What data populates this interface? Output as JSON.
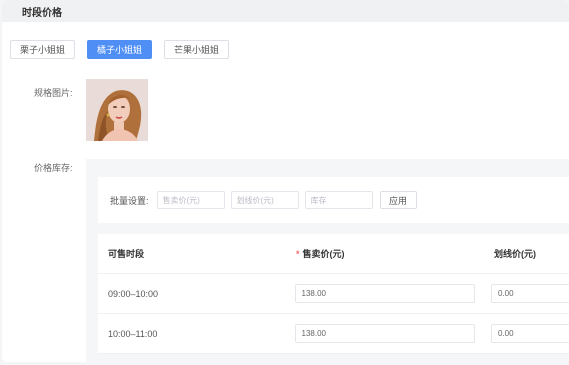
{
  "header": {
    "title": "时段价格"
  },
  "tabs": [
    {
      "label": "栗子小姐姐",
      "active": false
    },
    {
      "label": "橘子小姐姐",
      "active": true
    },
    {
      "label": "芒果小姐姐",
      "active": false
    }
  ],
  "spec_image": {
    "label": "规格图片:"
  },
  "stock": {
    "label": "价格库存:",
    "batch": {
      "label": "批量设置:",
      "price_placeholder": "售卖价(元)",
      "strike_placeholder": "划线价(元)",
      "stock_placeholder": "库存",
      "apply_label": "应用"
    },
    "table": {
      "columns": [
        "可售时段",
        "售卖价(元)",
        "划线价(元)"
      ],
      "required_mark": "*",
      "rows": [
        {
          "period": "09:00–10:00",
          "price": "138.00",
          "strike": "0.00"
        },
        {
          "period": "10:00–11:00",
          "price": "138.00",
          "strike": "0.00"
        }
      ]
    }
  },
  "colors": {
    "accent": "#4f8ef5",
    "required": "#f56c6c"
  }
}
